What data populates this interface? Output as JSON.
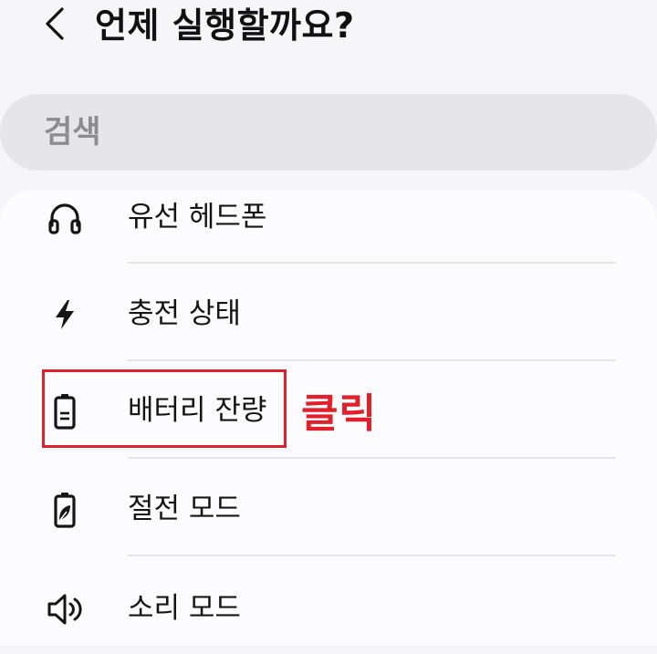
{
  "header": {
    "title": "언제 실행할까요?",
    "back_icon": "chevron-left-icon"
  },
  "search": {
    "placeholder": "검색"
  },
  "items": [
    {
      "label": "유선 헤드폰",
      "icon": "headphones-icon"
    },
    {
      "label": "충전 상태",
      "icon": "lightning-bolt-icon"
    },
    {
      "label": "배터리 잔량",
      "icon": "battery-icon"
    },
    {
      "label": "절전 모드",
      "icon": "battery-saver-leaf-icon"
    },
    {
      "label": "소리 모드",
      "icon": "speaker-icon"
    }
  ],
  "annotation": {
    "text": "클릭",
    "color": "#e0202b"
  },
  "colors": {
    "background": "#f6f6f8",
    "search_bg": "#e6e6ea",
    "card_bg": "#fcfcfe",
    "highlight": "#e0202b"
  }
}
